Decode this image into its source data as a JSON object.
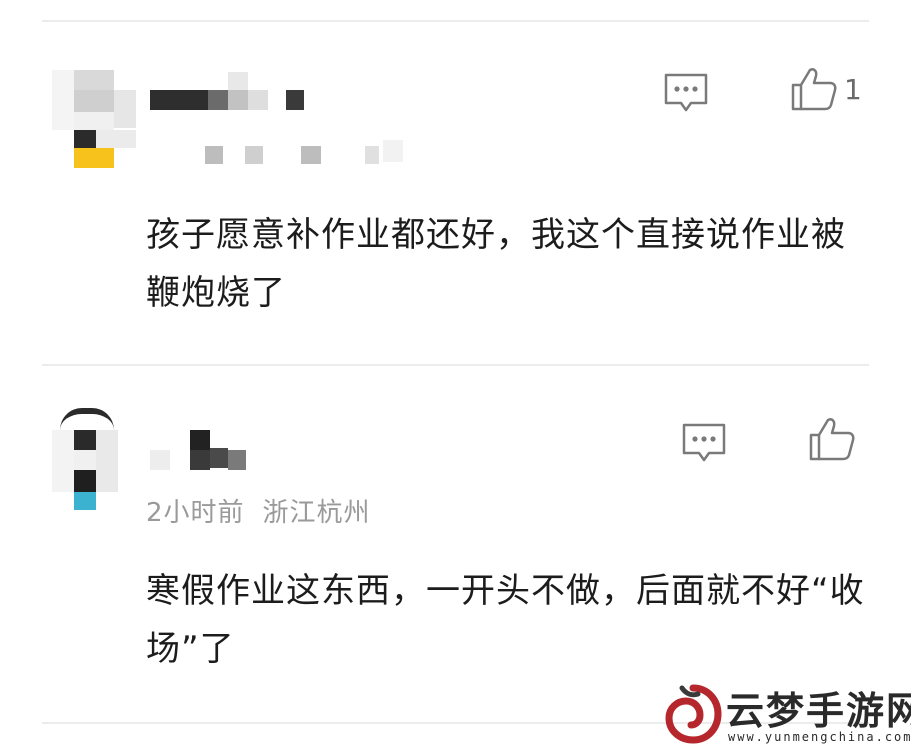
{
  "comments": [
    {
      "like_count": "1",
      "text": "孩子愿意补作业都还好，我这个直接说作业被鞭炮烧了",
      "reply_icon": "comment-bubble-icon",
      "like_icon": "thumbs-up-icon"
    },
    {
      "time": "2小时前",
      "location": "浙江杭州",
      "text": "寒假作业这东西，一开头不做，后面就不好“收场”了",
      "reply_icon": "comment-bubble-icon",
      "like_icon": "thumbs-up-icon"
    }
  ],
  "watermark": {
    "title": "云梦手游网",
    "url": "www.yunmengchina.com",
    "logo_color": "#b5272c"
  }
}
